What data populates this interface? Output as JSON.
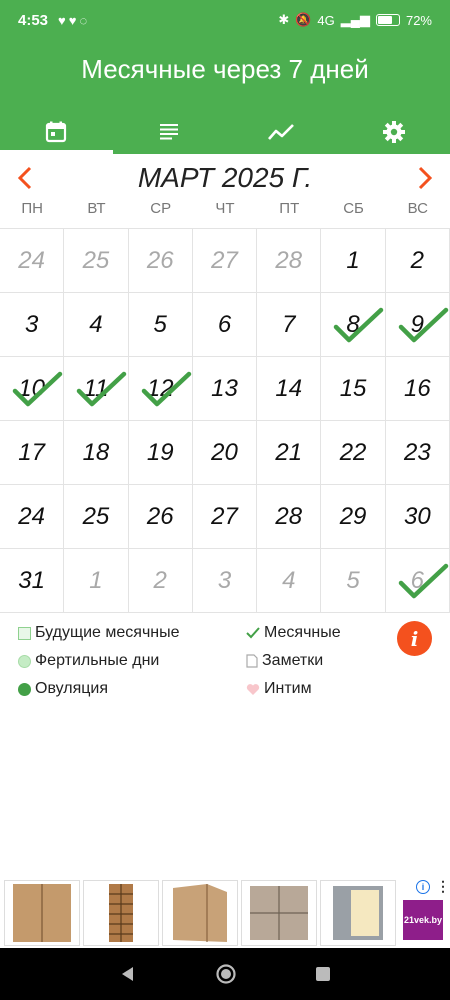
{
  "status": {
    "time": "4:53",
    "battery": "72%",
    "battery_level": 0.72,
    "network": "4G"
  },
  "app": {
    "title": "Месячные через 7 дней"
  },
  "tabs": [
    {
      "icon": "calendar-icon",
      "active": true
    },
    {
      "icon": "list-icon",
      "active": false
    },
    {
      "icon": "chart-icon",
      "active": false
    },
    {
      "icon": "gear-icon",
      "active": false
    }
  ],
  "calendar": {
    "month_title": "МАРТ 2025 Г.",
    "weekdays": [
      "ПН",
      "ВТ",
      "СР",
      "ЧТ",
      "ПТ",
      "СБ",
      "ВС"
    ],
    "days": [
      {
        "d": "24",
        "other": true,
        "check": false
      },
      {
        "d": "25",
        "other": true,
        "check": false
      },
      {
        "d": "26",
        "other": true,
        "check": false
      },
      {
        "d": "27",
        "other": true,
        "check": false
      },
      {
        "d": "28",
        "other": true,
        "check": false
      },
      {
        "d": "1",
        "other": false,
        "check": false
      },
      {
        "d": "2",
        "other": false,
        "check": false
      },
      {
        "d": "3",
        "other": false,
        "check": false
      },
      {
        "d": "4",
        "other": false,
        "check": false
      },
      {
        "d": "5",
        "other": false,
        "check": false
      },
      {
        "d": "6",
        "other": false,
        "check": false
      },
      {
        "d": "7",
        "other": false,
        "check": false
      },
      {
        "d": "8",
        "other": false,
        "check": true
      },
      {
        "d": "9",
        "other": false,
        "check": true
      },
      {
        "d": "10",
        "other": false,
        "check": true
      },
      {
        "d": "11",
        "other": false,
        "check": true
      },
      {
        "d": "12",
        "other": false,
        "check": true
      },
      {
        "d": "13",
        "other": false,
        "check": false
      },
      {
        "d": "14",
        "other": false,
        "check": false
      },
      {
        "d": "15",
        "other": false,
        "check": false
      },
      {
        "d": "16",
        "other": false,
        "check": false
      },
      {
        "d": "17",
        "other": false,
        "check": false
      },
      {
        "d": "18",
        "other": false,
        "check": false
      },
      {
        "d": "19",
        "other": false,
        "check": false
      },
      {
        "d": "20",
        "other": false,
        "check": false
      },
      {
        "d": "21",
        "other": false,
        "check": false
      },
      {
        "d": "22",
        "other": false,
        "check": false
      },
      {
        "d": "23",
        "other": false,
        "check": false
      },
      {
        "d": "24",
        "other": false,
        "check": false
      },
      {
        "d": "25",
        "other": false,
        "check": false
      },
      {
        "d": "26",
        "other": false,
        "check": false
      },
      {
        "d": "27",
        "other": false,
        "check": false
      },
      {
        "d": "28",
        "other": false,
        "check": false
      },
      {
        "d": "29",
        "other": false,
        "check": false
      },
      {
        "d": "30",
        "other": false,
        "check": false
      },
      {
        "d": "31",
        "other": false,
        "check": false
      },
      {
        "d": "1",
        "other": true,
        "check": false
      },
      {
        "d": "2",
        "other": true,
        "check": false
      },
      {
        "d": "3",
        "other": true,
        "check": false
      },
      {
        "d": "4",
        "other": true,
        "check": false
      },
      {
        "d": "5",
        "other": true,
        "check": false
      },
      {
        "d": "6",
        "other": true,
        "check": true
      }
    ]
  },
  "legend": {
    "future_periods": "Будущие месячные",
    "periods": "Месячные",
    "fertile": "Фертильные дни",
    "notes": "Заметки",
    "ovulation": "Овуляция",
    "intimacy": "Интим"
  },
  "info_button": "i",
  "ad": {
    "brand": "21vek.by"
  },
  "colors": {
    "primary": "#4caf50",
    "accent": "#f4511e",
    "check": "#43a047"
  }
}
